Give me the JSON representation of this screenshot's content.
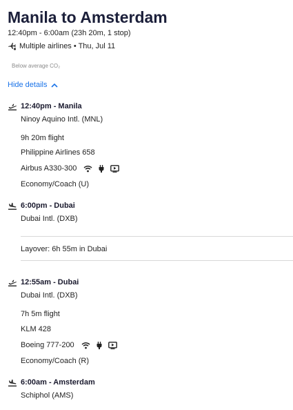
{
  "header": {
    "title": "Manila to Amsterdam",
    "summary": "12:40pm - 6:00am (23h 20m, 1 stop)",
    "airlines_line": "Multiple airlines • Thu, Jul 11",
    "co2_label": "Below average CO₂",
    "hide_details_label": "Hide details"
  },
  "segments": [
    {
      "departure": {
        "label": "12:40pm - Manila",
        "airport": "Ninoy Aquino Intl. (MNL)"
      },
      "duration": "9h 20m flight",
      "flight": "Philippine Airlines 658",
      "aircraft": "Airbus A330-300",
      "amenities": [
        "wifi-icon",
        "power-plug-icon",
        "entertainment-screen-icon"
      ],
      "cabin": "Economy/Coach (U)",
      "arrival": {
        "label": "6:00pm - Dubai",
        "airport": "Dubai Intl. (DXB)"
      }
    },
    {
      "departure": {
        "label": "12:55am - Dubai",
        "airport": "Dubai Intl. (DXB)"
      },
      "duration": "7h 5m flight",
      "flight": "KLM 428",
      "aircraft": "Boeing 777-200",
      "amenities": [
        "wifi-icon",
        "power-plug-icon",
        "entertainment-screen-icon"
      ],
      "cabin": "Economy/Coach (R)",
      "arrival": {
        "label": "6:00am - Amsterdam",
        "airport": "Schiphol (AMS)"
      }
    }
  ],
  "layover": {
    "label": "Layover: 6h 55m in Dubai"
  },
  "colors": {
    "link": "#1a73e8",
    "title": "#1b1f3a",
    "muted": "#8a8a8a",
    "divider": "#d8d8d8"
  }
}
